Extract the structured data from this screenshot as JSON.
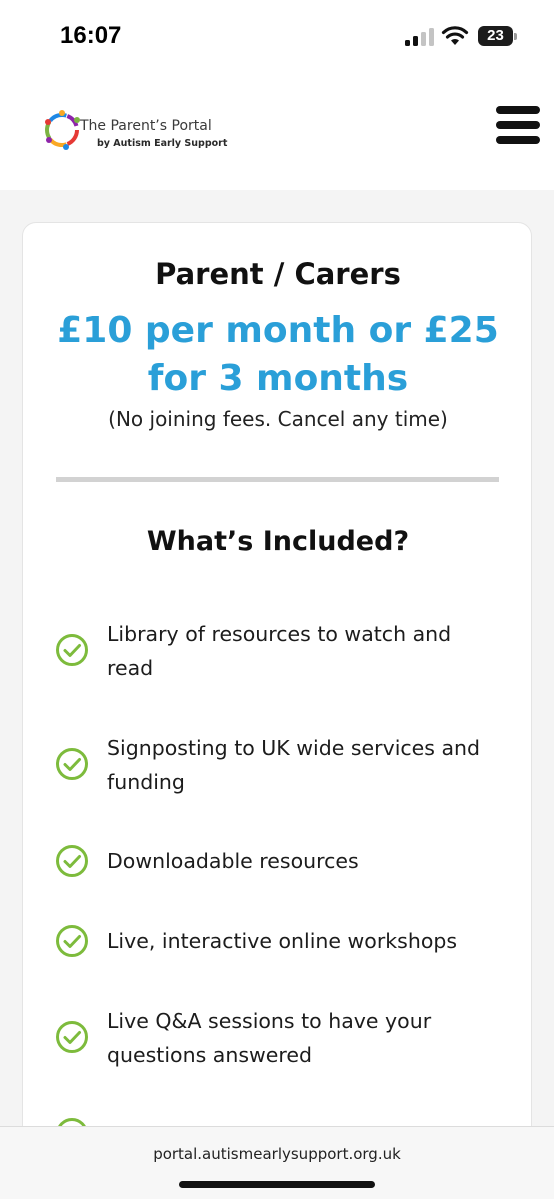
{
  "status_bar": {
    "time": "16:07",
    "battery": "23",
    "icons": [
      "signal-icon",
      "wifi-icon",
      "battery-icon"
    ]
  },
  "header": {
    "logo_title": "The Parent’s Portal",
    "logo_subtitle": "by Autism Early Support",
    "menu_icon": "hamburger-menu-icon",
    "logo_colors": [
      "#e53935",
      "#f9a825",
      "#7cb342",
      "#1e88e5",
      "#8e24aa"
    ]
  },
  "plan": {
    "title": "Parent / Carers",
    "price_line1": "£10 per month or £25",
    "price_line2": "for 3 months",
    "note": "(No joining fees. Cancel any time)",
    "accent_color": "#2a9fd8"
  },
  "included": {
    "heading": "What’s Included?",
    "check_color": "#7dbb3c",
    "features": [
      {
        "line1": "Library of resources to watch and",
        "line2": "read"
      },
      {
        "line1": "Signposting to UK wide services and",
        "line2": "funding"
      },
      {
        "line1": "Downloadable resources",
        "line2": ""
      },
      {
        "line1": "Live, interactive online workshops",
        "line2": ""
      },
      {
        "line1": "Live Q&A sessions to have your",
        "line2": "questions answered"
      }
    ]
  },
  "browser": {
    "url": "portal.autismearlysupport.org.uk"
  }
}
